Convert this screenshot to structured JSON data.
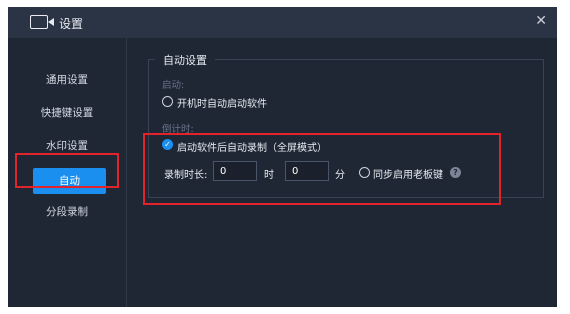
{
  "window": {
    "title": "设置",
    "close_glyph": "✕"
  },
  "sidebar": {
    "items": [
      {
        "label": "通用设置"
      },
      {
        "label": "快捷键设置"
      },
      {
        "label": "水印设置"
      },
      {
        "label": "自动",
        "active": true
      },
      {
        "label": "分段录制"
      }
    ]
  },
  "panel": {
    "title": "自动设置",
    "startup": {
      "label": "启动:",
      "option": "开机时自动启动软件",
      "checked": false
    },
    "countdown": {
      "label": "倒计时:",
      "option": "启动软件后自动录制（全屏模式）",
      "checked": true,
      "duration_label": "录制时长:",
      "hours_value": "0",
      "hours_unit": "时",
      "minutes_value": "0",
      "minutes_unit": "分",
      "sync_option": "同步启用老板键",
      "sync_checked": false,
      "help_glyph": "?"
    }
  },
  "colors": {
    "background": "#1f2735",
    "titlebar": "#2b3445",
    "accent": "#1a8ff0",
    "highlight": "#e2232c"
  }
}
